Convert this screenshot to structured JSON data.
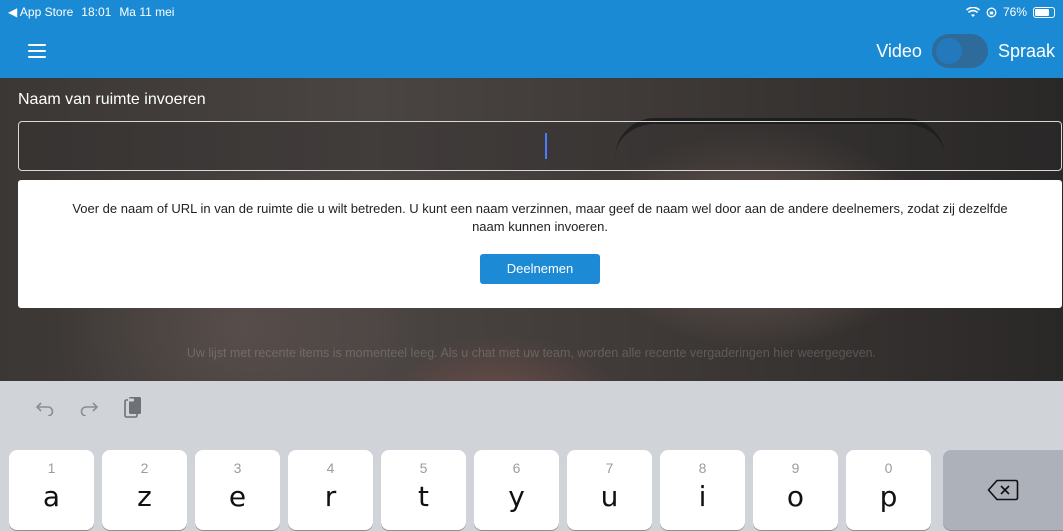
{
  "status_bar": {
    "back_app": "◀ App Store",
    "time": "18:01",
    "date": "Ma 11 mei",
    "battery_percent": "76%",
    "battery_level": 0.76
  },
  "nav": {
    "video_label": "Video",
    "speech_label": "Spraak",
    "toggle_state": "off"
  },
  "room": {
    "label": "Naam van ruimte invoeren",
    "value": "",
    "placeholder": ""
  },
  "card": {
    "message": "Voer de naam of URL in van de ruimte die u wilt betreden. U kunt een naam verzinnen, maar geef de naam wel door aan de andere deelnemers, zodat zij dezelfde naam kunnen invoeren.",
    "join_label": "Deelnemen"
  },
  "empty_message": "Uw lijst met recente items is momenteel leeg. Als u chat met uw team, worden alle recente vergaderingen hier weergegeven.",
  "keyboard": {
    "tools": [
      "undo-icon",
      "redo-icon",
      "paste-icon"
    ],
    "keys": [
      {
        "num": "1",
        "letter": "a"
      },
      {
        "num": "2",
        "letter": "z"
      },
      {
        "num": "3",
        "letter": "e"
      },
      {
        "num": "4",
        "letter": "r"
      },
      {
        "num": "5",
        "letter": "t"
      },
      {
        "num": "6",
        "letter": "y"
      },
      {
        "num": "7",
        "letter": "u"
      },
      {
        "num": "8",
        "letter": "i"
      },
      {
        "num": "9",
        "letter": "o"
      },
      {
        "num": "0",
        "letter": "p"
      }
    ],
    "backspace_icon": "backspace-icon"
  },
  "colors": {
    "accent": "#1a8ad4",
    "button": "#1d8ad6",
    "keyboard_bg": "#d0d3d8"
  }
}
